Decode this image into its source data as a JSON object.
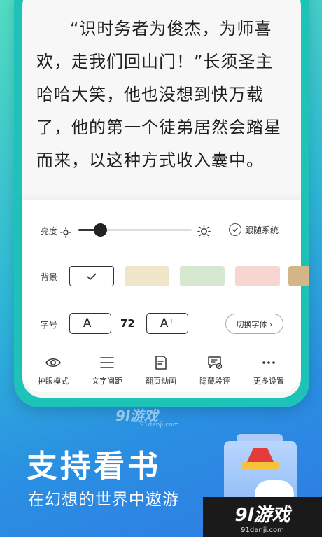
{
  "reader": {
    "paragraphs": [
      "“识时务者为俊杰，为师喜欢，走我们回山门！”长须圣主哈哈大笑，他也没想到快万载了，他的第一个徒弟居然会踏星而来，以这种方式收入囊中。"
    ]
  },
  "settings": {
    "brightness_label": "亮度",
    "brightness_level": 0.19,
    "follow_system_label": "跟随系统",
    "background_label": "背景",
    "background_colors": [
      "#ffffff",
      "#efe6c9",
      "#d6e8cf",
      "#f7d5d0",
      "#d2b688"
    ],
    "font_label": "字号",
    "font_decrease_label": "A⁻",
    "font_size_value": "72",
    "font_increase_label": "A⁺",
    "switch_font_label": "切换字体 ›"
  },
  "toolbar": {
    "items": [
      {
        "label": "护眼模式",
        "icon": "eye-icon"
      },
      {
        "label": "文字间距",
        "icon": "spacing-icon"
      },
      {
        "label": "翻页动画",
        "icon": "page-turn-icon"
      },
      {
        "label": "隐藏段评",
        "icon": "comment-hide-icon"
      },
      {
        "label": "更多设置",
        "icon": "more-icon"
      }
    ]
  },
  "watermark": {
    "mid_text": "9l游戏",
    "mid_sub": "91danji.com"
  },
  "promo": {
    "title": "支持看书",
    "subtitle": "在幻想的世界中遨游"
  },
  "logo": {
    "main": "9l游戏",
    "sub": "91danji.com"
  }
}
